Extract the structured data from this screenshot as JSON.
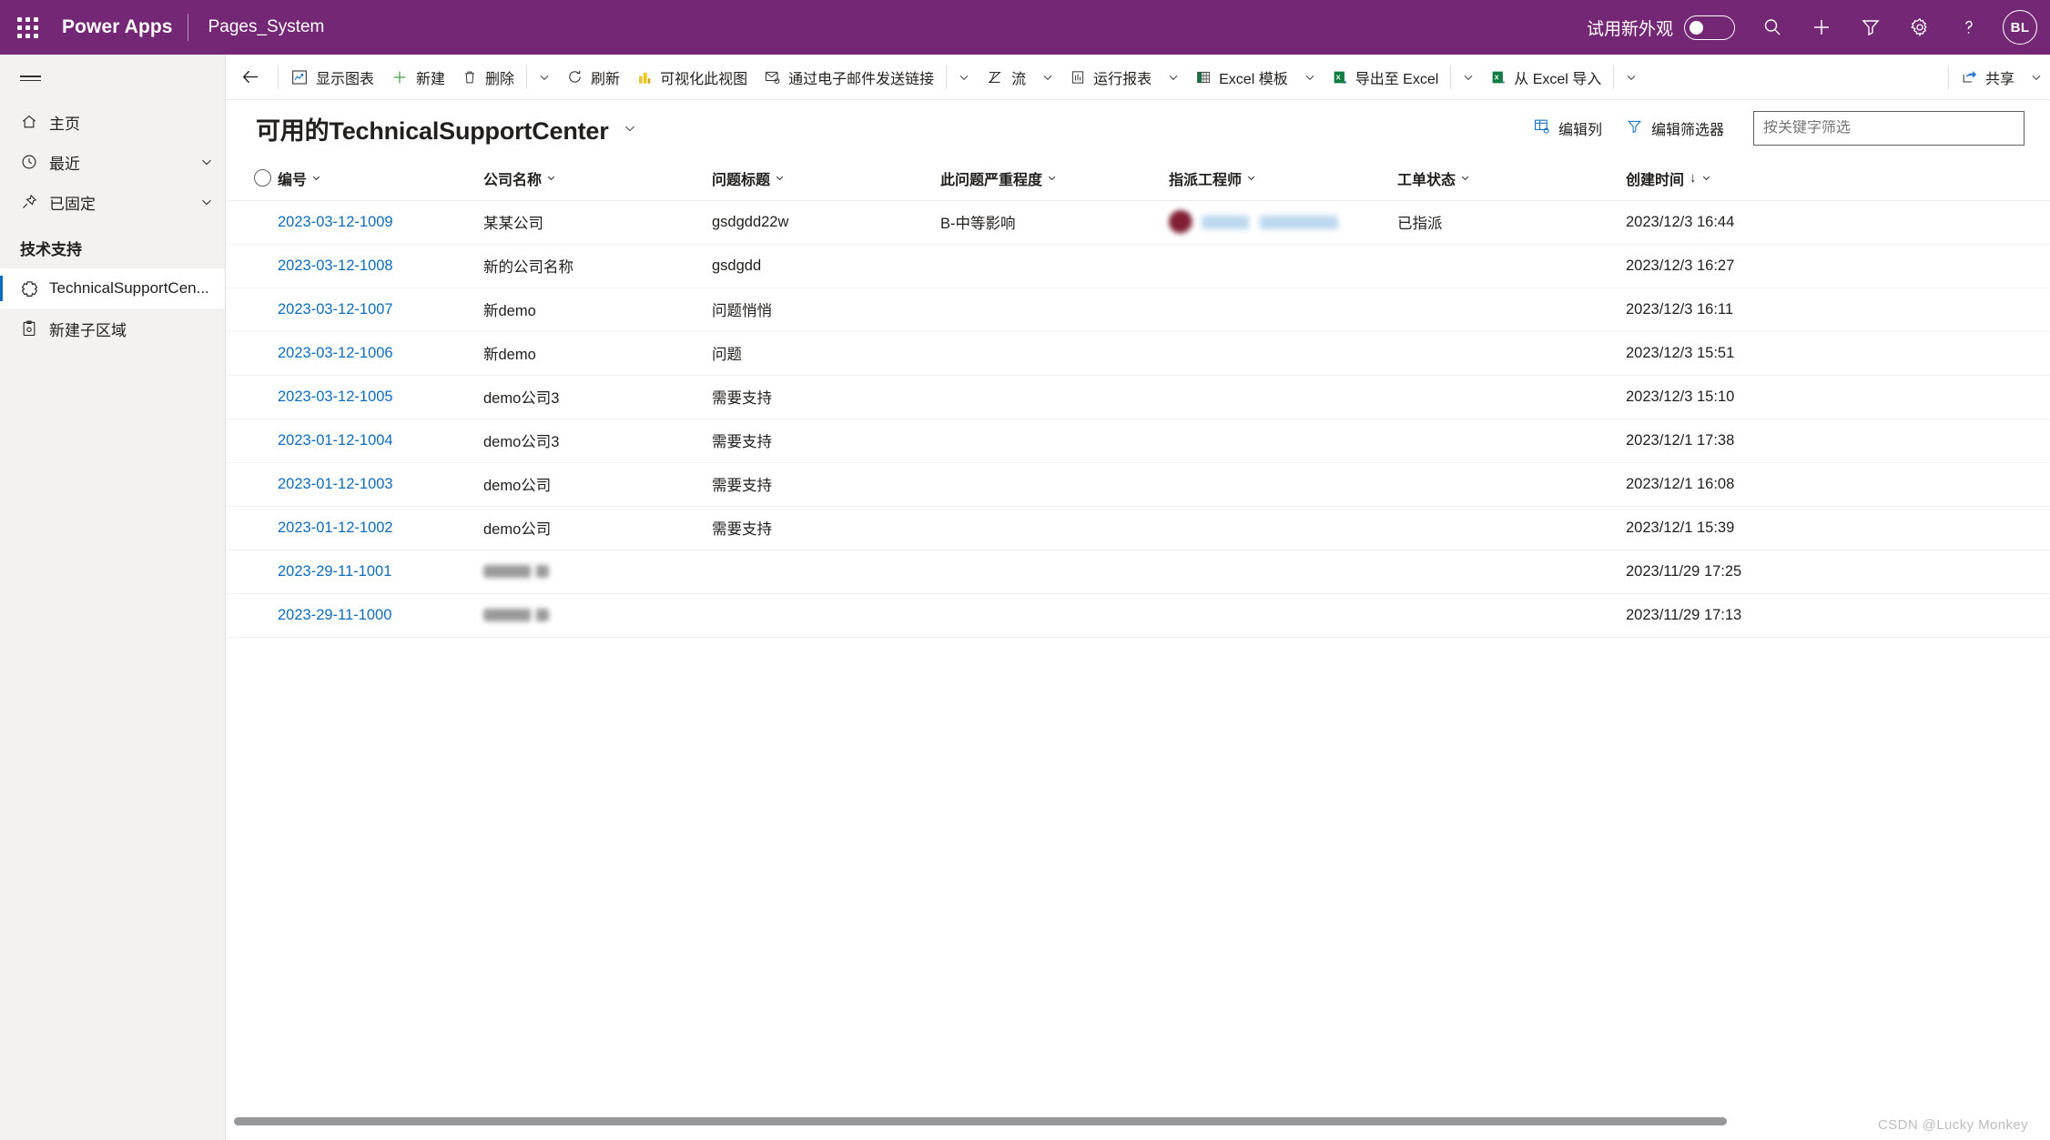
{
  "suitebar": {
    "waffle_label": "app-launcher",
    "brand": "Power Apps",
    "app_name": "Pages_System",
    "new_look_label": "试用新外观",
    "new_look_on": false,
    "icons": [
      "search-icon",
      "add-icon",
      "filter-icon",
      "settings-icon",
      "help-icon"
    ],
    "avatar_initials": "BL",
    "background_color": "#742774"
  },
  "sidebar": {
    "items": [
      {
        "label": "主页",
        "icon": "home-icon",
        "chevron": false,
        "selected": false
      },
      {
        "label": "最近",
        "icon": "clock-icon",
        "chevron": true,
        "selected": false
      },
      {
        "label": "已固定",
        "icon": "pin-icon",
        "chevron": true,
        "selected": false
      }
    ],
    "group_label": "技术支持",
    "group_items": [
      {
        "label": "TechnicalSupportCen...",
        "icon": "gear-shape-icon",
        "selected": true
      },
      {
        "label": "新建子区域",
        "icon": "clipboard-gear-icon",
        "selected": false
      }
    ]
  },
  "commandbar": {
    "back_label": "back-arrow",
    "items": [
      {
        "label": "显示图表",
        "icon": "chart-icon",
        "chevron": false,
        "divider_after": false
      },
      {
        "label": "新建",
        "icon": "plus-icon",
        "chevron": false,
        "divider_after": false
      },
      {
        "label": "删除",
        "icon": "trash-icon",
        "chevron": true,
        "divider_after": true
      },
      {
        "label": "刷新",
        "icon": "refresh-icon",
        "chevron": false,
        "divider_after": false
      },
      {
        "label": "可视化此视图",
        "icon": "powerbi-icon",
        "chevron": false,
        "divider_after": false
      },
      {
        "label": "通过电子邮件发送链接",
        "icon": "email-link-icon",
        "chevron": true,
        "divider_after": true
      },
      {
        "label": "流",
        "icon": "flow-icon",
        "chevron": true,
        "divider_after": false
      },
      {
        "label": "运行报表",
        "icon": "report-icon",
        "chevron": true,
        "divider_after": false
      },
      {
        "label": "Excel 模板",
        "icon": "excel-template-icon",
        "chevron": true,
        "divider_after": false
      },
      {
        "label": "导出至 Excel",
        "icon": "excel-export-icon",
        "chevron": true,
        "divider_after": true
      },
      {
        "label": "从 Excel 导入",
        "icon": "excel-import-icon",
        "chevron": true,
        "divider_after": true
      }
    ],
    "share": {
      "label": "共享",
      "icon": "share-icon",
      "chevron": true
    }
  },
  "view": {
    "title": "可用的TechnicalSupportCenter",
    "edit_columns_label": "编辑列",
    "edit_filters_label": "编辑筛选器",
    "search_placeholder": "按关键字筛选",
    "search_value": ""
  },
  "grid": {
    "columns": [
      {
        "label": "编号",
        "key": "id",
        "sorted": false
      },
      {
        "label": "公司名称",
        "key": "company",
        "sorted": false
      },
      {
        "label": "问题标题",
        "key": "issue",
        "sorted": false
      },
      {
        "label": "此问题严重程度",
        "key": "severity",
        "sorted": false
      },
      {
        "label": "指派工程师",
        "key": "engineer",
        "sorted": false
      },
      {
        "label": "工单状态",
        "key": "status",
        "sorted": false
      },
      {
        "label": "创建时间",
        "key": "created",
        "sorted": true,
        "sort_dir": "↓"
      }
    ],
    "rows": [
      {
        "id": "2023-03-12-1009",
        "company": "某某公司",
        "issue": "gsdgdd22w",
        "severity": "B-中等影响",
        "engineer": "",
        "engineer_redacted": true,
        "status": "已指派",
        "created": "2023/12/3 16:44"
      },
      {
        "id": "2023-03-12-1008",
        "company": "新的公司名称",
        "issue": "gsdgdd",
        "severity": "",
        "engineer": "",
        "engineer_redacted": false,
        "status": "",
        "created": "2023/12/3 16:27"
      },
      {
        "id": "2023-03-12-1007",
        "company": "新demo",
        "issue": "问题悄悄",
        "severity": "",
        "engineer": "",
        "engineer_redacted": false,
        "status": "",
        "created": "2023/12/3 16:11"
      },
      {
        "id": "2023-03-12-1006",
        "company": "新demo",
        "issue": "问题",
        "severity": "",
        "engineer": "",
        "engineer_redacted": false,
        "status": "",
        "created": "2023/12/3 15:51"
      },
      {
        "id": "2023-03-12-1005",
        "company": "demo公司3",
        "issue": "需要支持",
        "severity": "",
        "engineer": "",
        "engineer_redacted": false,
        "status": "",
        "created": "2023/12/3 15:10"
      },
      {
        "id": "2023-01-12-1004",
        "company": "demo公司3",
        "issue": "需要支持",
        "severity": "",
        "engineer": "",
        "engineer_redacted": false,
        "status": "",
        "created": "2023/12/1 17:38"
      },
      {
        "id": "2023-01-12-1003",
        "company": "demo公司",
        "issue": "需要支持",
        "severity": "",
        "engineer": "",
        "engineer_redacted": false,
        "status": "",
        "created": "2023/12/1 16:08"
      },
      {
        "id": "2023-01-12-1002",
        "company": "demo公司",
        "issue": "需要支持",
        "severity": "",
        "engineer": "",
        "engineer_redacted": false,
        "status": "",
        "created": "2023/12/1 15:39"
      },
      {
        "id": "2023-29-11-1001",
        "company": "",
        "company_redacted": true,
        "issue": "",
        "severity": "",
        "engineer": "",
        "engineer_redacted": false,
        "status": "",
        "created": "2023/11/29 17:25"
      },
      {
        "id": "2023-29-11-1000",
        "company": "",
        "company_redacted": true,
        "issue": "",
        "severity": "",
        "engineer": "",
        "engineer_redacted": false,
        "status": "",
        "created": "2023/11/29 17:13"
      }
    ]
  },
  "footer": {
    "watermark": "CSDN @Lucky Monkey"
  },
  "colors": {
    "brand_purple": "#742774",
    "link_blue": "#0f6cbd",
    "sidebar_bg": "#f3f2f1",
    "excel_green": "#107c41"
  }
}
